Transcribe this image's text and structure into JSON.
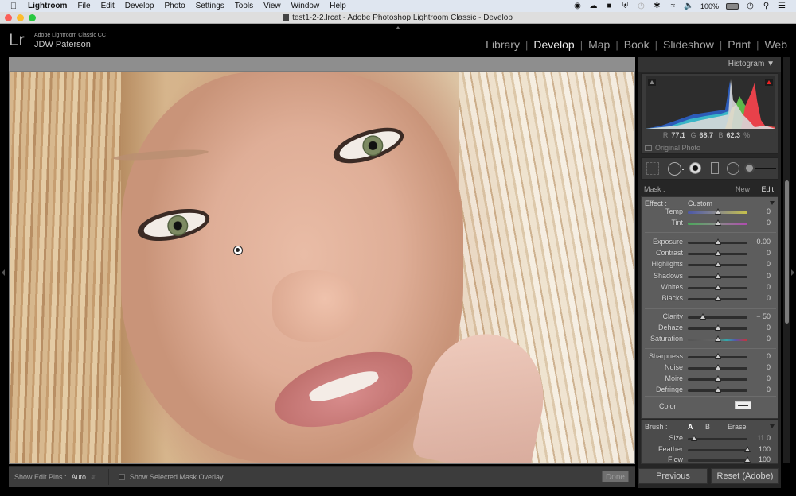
{
  "menubar": {
    "app_name": "Lightroom",
    "items": [
      "File",
      "Edit",
      "Develop",
      "Photo",
      "Settings",
      "Tools",
      "View",
      "Window",
      "Help"
    ],
    "battery": "100%"
  },
  "window": {
    "title": "test1-2-2.lrcat - Adobe Photoshop Lightroom Classic - Develop"
  },
  "identity": {
    "logo": "Lr",
    "product": "Adobe Lightroom Classic CC",
    "user": "JDW Paterson"
  },
  "modules": {
    "items": [
      "Library",
      "Develop",
      "Map",
      "Book",
      "Slideshow",
      "Print",
      "Web"
    ],
    "active": "Develop"
  },
  "toolbar": {
    "show_edit_pins_label": "Show Edit Pins :",
    "show_edit_pins_value": "Auto",
    "mask_overlay_label": "Show Selected Mask Overlay",
    "mask_overlay_checked": false,
    "done_label": "Done"
  },
  "histogram": {
    "title": "Histogram",
    "r_label": "R",
    "r_value": "77.1",
    "g_label": "G",
    "g_value": "68.7",
    "b_label": "B",
    "b_value": "62.3",
    "unit": "%",
    "original_photo_label": "Original Photo",
    "colors": {
      "red": "#e8414a",
      "green": "#5cb84a",
      "blue": "#2c5bb8",
      "yellow": "#f0d43a",
      "cyan": "#3ab6c7",
      "gray": "#d8d8d8"
    }
  },
  "mask": {
    "label": "Mask :",
    "new_label": "New",
    "edit_label": "Edit"
  },
  "effect": {
    "label": "Effect :",
    "preset": "Custom",
    "sliders": [
      {
        "name": "Temp",
        "value": "0",
        "pos": 0.5
      },
      {
        "name": "Tint",
        "value": "0",
        "pos": 0.5
      },
      {
        "name": "Exposure",
        "value": "0.00",
        "pos": 0.5
      },
      {
        "name": "Contrast",
        "value": "0",
        "pos": 0.5
      },
      {
        "name": "Highlights",
        "value": "0",
        "pos": 0.5
      },
      {
        "name": "Shadows",
        "value": "0",
        "pos": 0.5
      },
      {
        "name": "Whites",
        "value": "0",
        "pos": 0.5
      },
      {
        "name": "Blacks",
        "value": "0",
        "pos": 0.5
      },
      {
        "name": "Clarity",
        "value": "− 50",
        "pos": 0.25
      },
      {
        "name": "Dehaze",
        "value": "0",
        "pos": 0.5
      },
      {
        "name": "Saturation",
        "value": "0",
        "pos": 0.5
      },
      {
        "name": "Sharpness",
        "value": "0",
        "pos": 0.5
      },
      {
        "name": "Noise",
        "value": "0",
        "pos": 0.5
      },
      {
        "name": "Moire",
        "value": "0",
        "pos": 0.5
      },
      {
        "name": "Defringe",
        "value": "0",
        "pos": 0.5
      }
    ],
    "color_label": "Color"
  },
  "brush": {
    "label": "Brush :",
    "a_label": "A",
    "b_label": "B",
    "erase_label": "Erase",
    "sliders": [
      {
        "name": "Size",
        "value": "11.0",
        "pos": 0.1
      },
      {
        "name": "Feather",
        "value": "100",
        "pos": 1.0
      },
      {
        "name": "Flow",
        "value": "100",
        "pos": 1.0
      }
    ]
  },
  "buttons": {
    "previous": "Previous",
    "reset": "Reset (Adobe)"
  }
}
